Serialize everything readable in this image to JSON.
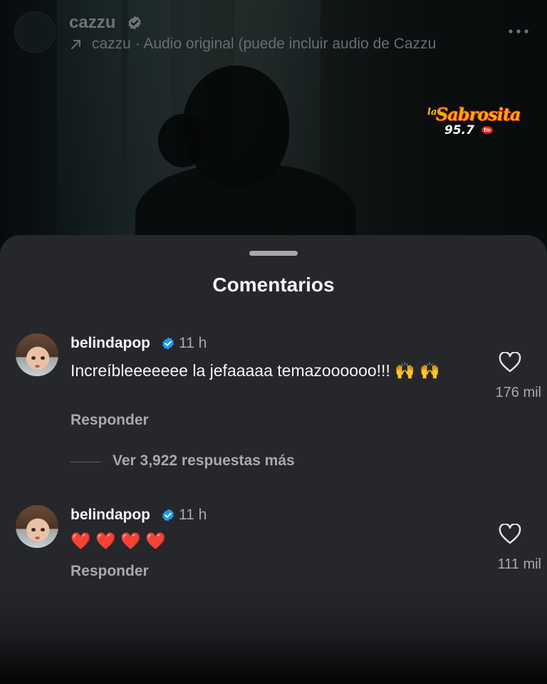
{
  "post": {
    "username": "cazzu",
    "audio": "cazzu · Audio original  (puede incluir audio de Cazzu"
  },
  "logo": {
    "prefix": "la",
    "name": "Sabrosita",
    "frequency": "95.7",
    "band": "fm"
  },
  "sheet": {
    "title": "Comentarios"
  },
  "comments": [
    {
      "user": "belindapop",
      "time": "11 h",
      "text": "Increíbleeeeeee la jefaaaaa temazoooooo!!! 🙌 🙌",
      "reply_label": "Responder",
      "likes": "176 mil",
      "view_replies": "Ver 3,922 respuestas más"
    },
    {
      "user": "belindapop",
      "time": "11 h",
      "text": "❤️ ❤️ ❤️ ❤️",
      "reply_label": "Responder",
      "likes": "111 mil"
    }
  ],
  "icons": {
    "verified": "verified-badge-icon",
    "heart": "heart-outline-icon",
    "more": "more-dots-icon",
    "audio_arrow": "arrow-up-right-icon"
  },
  "colors": {
    "sheet_bg": "#26272b",
    "verified_blue": "#1d9bf0",
    "secondary_text": "#a8a9ad"
  }
}
